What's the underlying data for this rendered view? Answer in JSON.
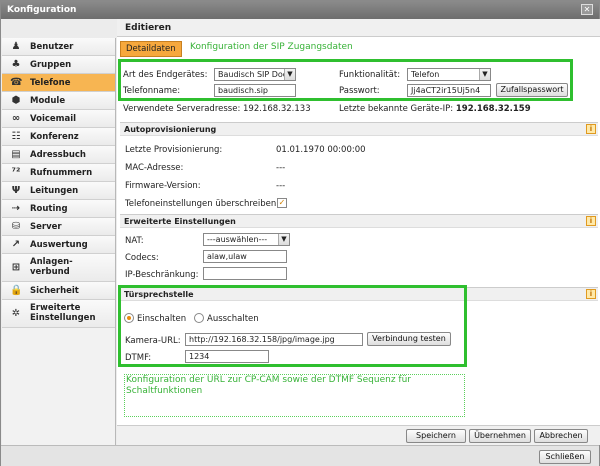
{
  "window": {
    "title": "Konfiguration"
  },
  "sidebar": {
    "items": [
      {
        "label": "Benutzer",
        "icon": "person-icon",
        "glyph": "♟"
      },
      {
        "label": "Gruppen",
        "icon": "group-icon",
        "glyph": "♣"
      },
      {
        "label": "Telefone",
        "icon": "telephone-icon",
        "glyph": "☎",
        "active": true
      },
      {
        "label": "Module",
        "icon": "module-icon",
        "glyph": "⬢"
      },
      {
        "label": "Voicemail",
        "icon": "voicemail-icon",
        "glyph": "∞"
      },
      {
        "label": "Konferenz",
        "icon": "conference-icon",
        "glyph": "☷"
      },
      {
        "label": "Adressbuch",
        "icon": "addressbook-icon",
        "glyph": "▤"
      },
      {
        "label": "Rufnummern",
        "icon": "numbers-icon",
        "glyph": "⁷²"
      },
      {
        "label": "Leitungen",
        "icon": "lines-icon",
        "glyph": "Ψ"
      },
      {
        "label": "Routing",
        "icon": "routing-icon",
        "glyph": "⇢"
      },
      {
        "label": "Server",
        "icon": "server-icon",
        "glyph": "⛁"
      },
      {
        "label": "Auswertung",
        "icon": "chart-icon",
        "glyph": "↗"
      },
      {
        "label": "Anlagen-verbund",
        "icon": "network-icon",
        "glyph": "⊞",
        "two": true
      },
      {
        "label": "Sicherheit",
        "icon": "lock-icon",
        "glyph": "🔒"
      },
      {
        "label": "Erweiterte Einstellungen",
        "icon": "advanced-icon",
        "glyph": "✲",
        "two": true
      }
    ]
  },
  "content": {
    "title": "Editieren",
    "tab": "Detaildaten",
    "annotation_top": "Konfiguration der SIP Zugangsdaten",
    "device_type_label": "Art des Endgerätes:",
    "device_type_value": "Baudisch SIP Doo",
    "function_label": "Funktionalität:",
    "function_value": "Telefon",
    "phone_name_label": "Telefonname:",
    "phone_name_value": "baudisch.sip",
    "password_label": "Passwort:",
    "password_value": "Jj4aCT2ir15Uj5n4",
    "random_password_button": "Zufallspasswort",
    "server_address_label": "Verwendete Serveradresse:",
    "server_address_value": "192.168.32.133",
    "device_ip_label": "Letzte bekannte Geräte-IP:",
    "device_ip_value": "192.168.32.159"
  },
  "autoprov": {
    "title": "Autoprovisionierung",
    "last_label": "Letzte Provisionierung:",
    "last_value": "01.01.1970 00:00:00",
    "mac_label": "MAC-Adresse:",
    "mac_value": "---",
    "firmware_label": "Firmware-Version:",
    "firmware_value": "---",
    "overwrite_label": "Telefoneinstellungen überschreiben:",
    "overwrite_checked": true
  },
  "advanced": {
    "title": "Erweiterte Einstellungen",
    "nat_label": "NAT:",
    "nat_value": "---auswählen---",
    "codecs_label": "Codecs:",
    "codecs_value": "alaw,ulaw",
    "ip_label": "IP-Beschränkung:",
    "ip_value": ""
  },
  "door": {
    "title": "Türsprechstelle",
    "on_label": "Einschalten",
    "off_label": "Ausschalten",
    "camera_label": "Kamera-URL:",
    "camera_value": "http://192.168.32.158/jpg/image.jpg",
    "test_button": "Verbindung testen",
    "dtmf_label": "DTMF:",
    "dtmf_value": "1234",
    "annotation": "Konfiguration der URL zur CP-CAM sowie der DTMF Sequenz für Schaltfunktionen"
  },
  "footer": {
    "save": "Speichern",
    "apply": "Übernehmen",
    "cancel": "Abbrechen",
    "close": "Schließen"
  },
  "colors": {
    "accent": "#f6a83d",
    "highlight": "#2fbf2f"
  }
}
